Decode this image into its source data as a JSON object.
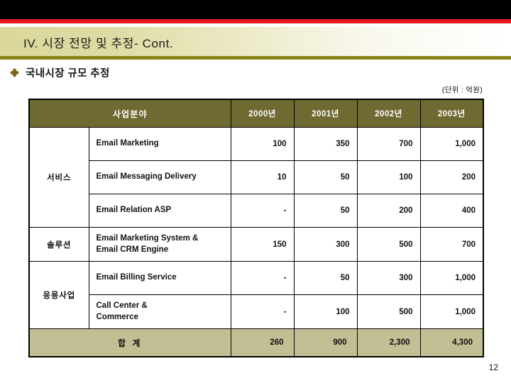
{
  "slide": {
    "title": "IV. 시장 전망 및 추정- Cont.",
    "subtitle": "국내시장 규모 추정",
    "subtitle_bullet_icon": "flower-bullet-icon",
    "unit_note": "(단위 :  억원)",
    "page_number": "12"
  },
  "colors": {
    "top_bar": "#000000",
    "accent_red": "#e8171f",
    "title_band_left": "#d9d79a",
    "title_band_right": "#ffffff",
    "band_olive": "#8b8315",
    "table_header_bg": "#6f6a31",
    "table_header_text": "#ffffff",
    "total_row_bg": "#c3bf95",
    "bullet_gold": "#7a6617"
  },
  "table": {
    "headers": [
      "사업분야",
      "2000년",
      "2001년",
      "2002년",
      "2003년"
    ],
    "groups": [
      {
        "category": "서비스",
        "rowspan": 3,
        "rows": [
          {
            "item": "Email Marketing",
            "values": [
              "100",
              "350",
              "700",
              "1,000"
            ]
          },
          {
            "item": "Email Messaging Delivery",
            "values": [
              "10",
              "50",
              "100",
              "200"
            ]
          },
          {
            "item": "Email Relation ASP",
            "values": [
              "-",
              "50",
              "200",
              "400"
            ]
          }
        ]
      },
      {
        "category": "솔루션",
        "rowspan": 1,
        "rows": [
          {
            "item": "Email Marketing System &\nEmail CRM Engine",
            "values": [
              "150",
              "300",
              "500",
              "700"
            ]
          }
        ]
      },
      {
        "category": "응용사업",
        "rowspan": 2,
        "rows": [
          {
            "item": "Email Billing Service",
            "values": [
              "-",
              "50",
              "300",
              "1,000"
            ]
          },
          {
            "item": "Call Center &\nCommerce",
            "values": [
              "-",
              "100",
              "500",
              "1,000"
            ]
          }
        ]
      }
    ],
    "total": {
      "label": "합 계",
      "values": [
        "260",
        "900",
        "2,300",
        "4,300"
      ]
    }
  }
}
